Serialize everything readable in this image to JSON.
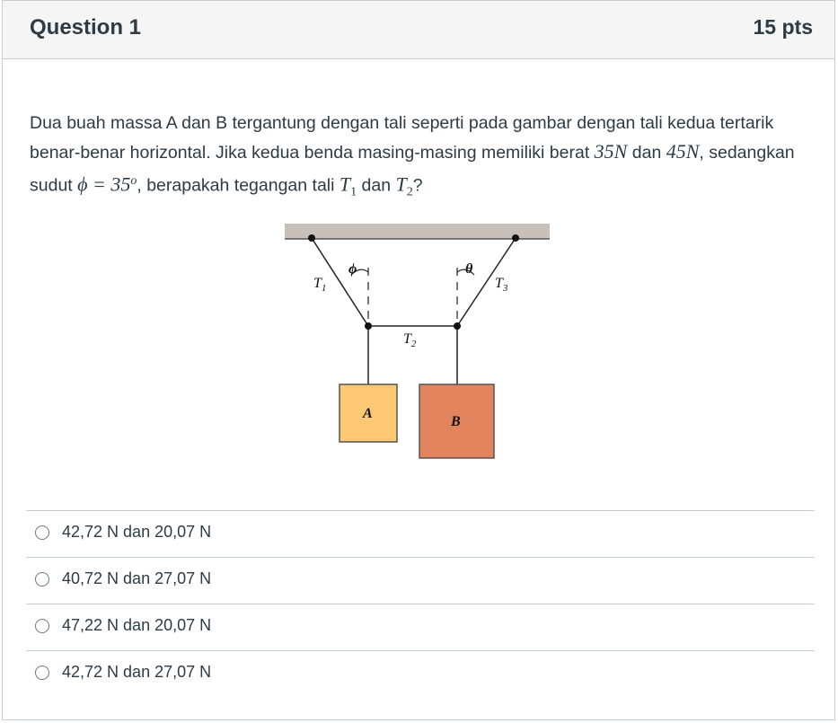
{
  "question": {
    "title": "Question 1",
    "points": "15 pts",
    "text_part1": "Dua buah massa A dan B tergantung dengan tali seperti pada gambar dengan tali kedua tertarik benar-benar horizontal. Jika kedua benda masing-masing memiliki berat ",
    "weight_a": "35N",
    "text_part2": " dan ",
    "weight_b": "45N",
    "text_part3": ", sedangkan sudut ",
    "angle_eq": "ϕ = 35",
    "angle_sup": "o",
    "text_part4": ", berapakah tegangan tali ",
    "t1": "T",
    "t1_sub": "1",
    "text_part5": " dan ",
    "t2": "T",
    "t2_sub": "2",
    "text_part6": "?"
  },
  "figure": {
    "label_phi": "ϕ",
    "label_theta": "θ",
    "label_t1": "T",
    "label_t1_sub": "1",
    "label_t2": "T",
    "label_t2_sub": "2",
    "label_t3": "T",
    "label_t3_sub": "3",
    "label_a": "A",
    "label_b": "B",
    "color_ceiling": "#c8bfb8",
    "color_block_a": "#fcc873",
    "color_block_b": "#e2845e"
  },
  "answers": [
    {
      "label": "42,72 N dan 20,07 N",
      "selected": false
    },
    {
      "label": "40,72 N dan 27,07 N",
      "selected": false
    },
    {
      "label": "47,22 N dan 20,07 N",
      "selected": false
    },
    {
      "label": "42,72 N dan 27,07 N",
      "selected": false
    }
  ]
}
